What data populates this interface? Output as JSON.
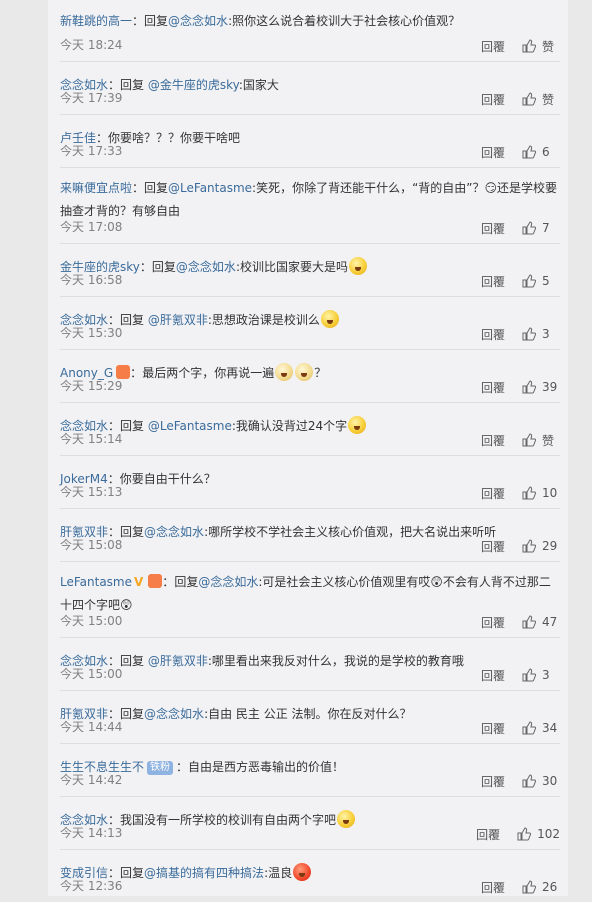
{
  "reply_label": "回覆",
  "comments": [
    {
      "user": "新鞋跳的高一",
      "sep": "：",
      "prefix": "回复",
      "mention": "@念念如水",
      "body": ":照你这么说合着校训大于社会核心价值观？",
      "time": "今天 18:24",
      "likes": "赞"
    },
    {
      "user": "念念如水",
      "sep": "：",
      "prefix": "回复 ",
      "mention": "@金牛座的虎sky",
      "body": ":国家大",
      "time": "今天 17:39",
      "likes": "赞"
    },
    {
      "user": "卢壬佳",
      "sep": "：",
      "prefix": "",
      "mention": "",
      "body": "你要啥？？？你要干啥吧",
      "time": "今天 17:33",
      "likes": "6"
    },
    {
      "user": "来嘛便宜点啦",
      "sep": "：",
      "prefix": "回复",
      "mention": "@LeFantasme",
      "body": ":笑死，你除了背还能干什么，“背的自由”？😏还是学校要抽查才背的？有够自由",
      "time": "今天 17:08",
      "likes": "7"
    },
    {
      "user": "金牛座的虎sky",
      "sep": "：",
      "prefix": "回复",
      "mention": "@念念如水",
      "body": ":校训比国家要大是吗",
      "time": "今天 16:58",
      "likes": "5"
    },
    {
      "user": "念念如水",
      "sep": "：",
      "prefix": "回复 ",
      "mention": "@肝氪双非",
      "body": ":思想政治课是校训么",
      "time": "今天 15:30",
      "likes": "3"
    },
    {
      "user": "Anony_G",
      "sep": "：",
      "prefix": "",
      "mention": "",
      "body": "最后两个字，你再说一遍",
      "time": "今天 15:29",
      "likes": "39"
    },
    {
      "user": "念念如水",
      "sep": "：",
      "prefix": "回复 ",
      "mention": "@LeFantasme",
      "body": ":我确认没背过24个字",
      "time": "今天 15:14",
      "likes": "赞"
    },
    {
      "user": "JokerM4",
      "sep": "：",
      "prefix": "",
      "mention": "",
      "body": "你要自由干什么？",
      "time": "今天 15:13",
      "likes": "10"
    },
    {
      "user": "肝氪双非",
      "sep": "：",
      "prefix": "回复",
      "mention": "@念念如水",
      "body": ":哪所学校不学社会主义核心价值观，把大名说出来听听",
      "time": "今天 15:08",
      "likes": "29"
    },
    {
      "user": "LeFantasme",
      "sep": "：",
      "prefix": "回复",
      "mention": "@念念如水",
      "body": ":可是社会主义核心价值观里有哎😲不会有人背不过那二十四个字吧😲",
      "time": "今天 15:00",
      "likes": "47"
    },
    {
      "user": "念念如水",
      "sep": "：",
      "prefix": "回复 ",
      "mention": "@肝氪双非",
      "body": ":哪里看出来我反对什么，我说的是学校的教育哦",
      "time": "今天 15:00",
      "likes": "3"
    },
    {
      "user": "肝氪双非",
      "sep": "：",
      "prefix": "回复",
      "mention": "@念念如水",
      "body": ":自由 民主 公正 法制。你在反对什么？",
      "time": "今天 14:44",
      "likes": "34"
    },
    {
      "user": "生生不息生生不",
      "sep": "：",
      "prefix": "",
      "mention": "",
      "body": "自由是西方恶毒输出的价值！",
      "time": "今天 14:42",
      "likes": "30",
      "badge": "铁粉"
    },
    {
      "user": "念念如水",
      "sep": "：",
      "prefix": "",
      "mention": "",
      "body": "我国没有一所学校的校训有自由两个字吧",
      "time": "今天 14:13",
      "likes": "102"
    },
    {
      "user": "变成引信",
      "sep": "：",
      "prefix": "回复",
      "mention": "@搞基的搞有四种搞法",
      "body": ":温良",
      "time": "今天 12:36",
      "likes": "26"
    }
  ]
}
